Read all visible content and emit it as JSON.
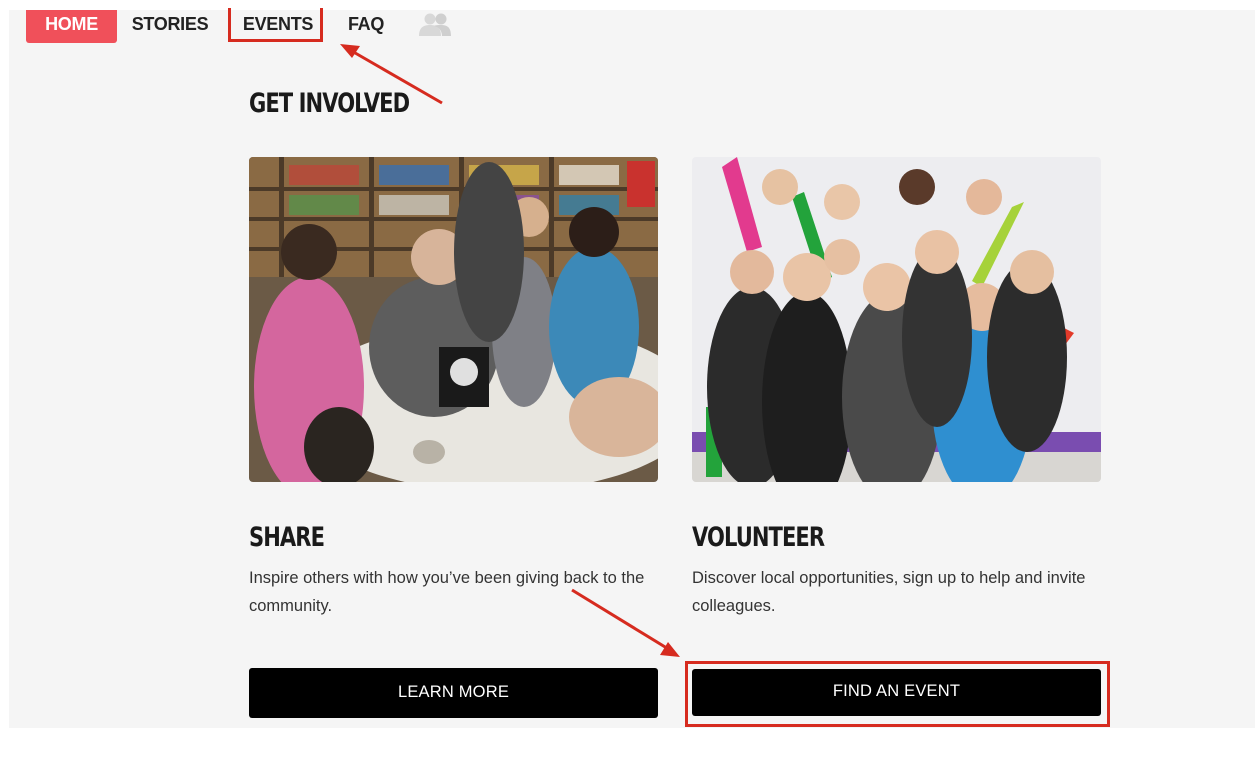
{
  "nav": {
    "home": "HOME",
    "stories": "STORIES",
    "events": "EVENTS",
    "faq": "FAQ",
    "people_icon": "people-icon"
  },
  "main": {
    "heading": "GET INVOLVED",
    "cards": [
      {
        "title": "SHARE",
        "description": "Inspire others with how you’ve been giving back to the community.",
        "button": "LEARN MORE",
        "image": "kids-library-photo"
      },
      {
        "title": "VOLUNTEER",
        "description": "Discover local opportunities, sign up to help and invite colleagues.",
        "button": "FIND AN EVENT",
        "image": "volunteers-crayons-photo"
      }
    ]
  },
  "colors": {
    "home_tab": "#f0505a",
    "annotation_red": "#d62b1f",
    "button_bg": "#000000",
    "page_bg": "#f5f5f5"
  }
}
